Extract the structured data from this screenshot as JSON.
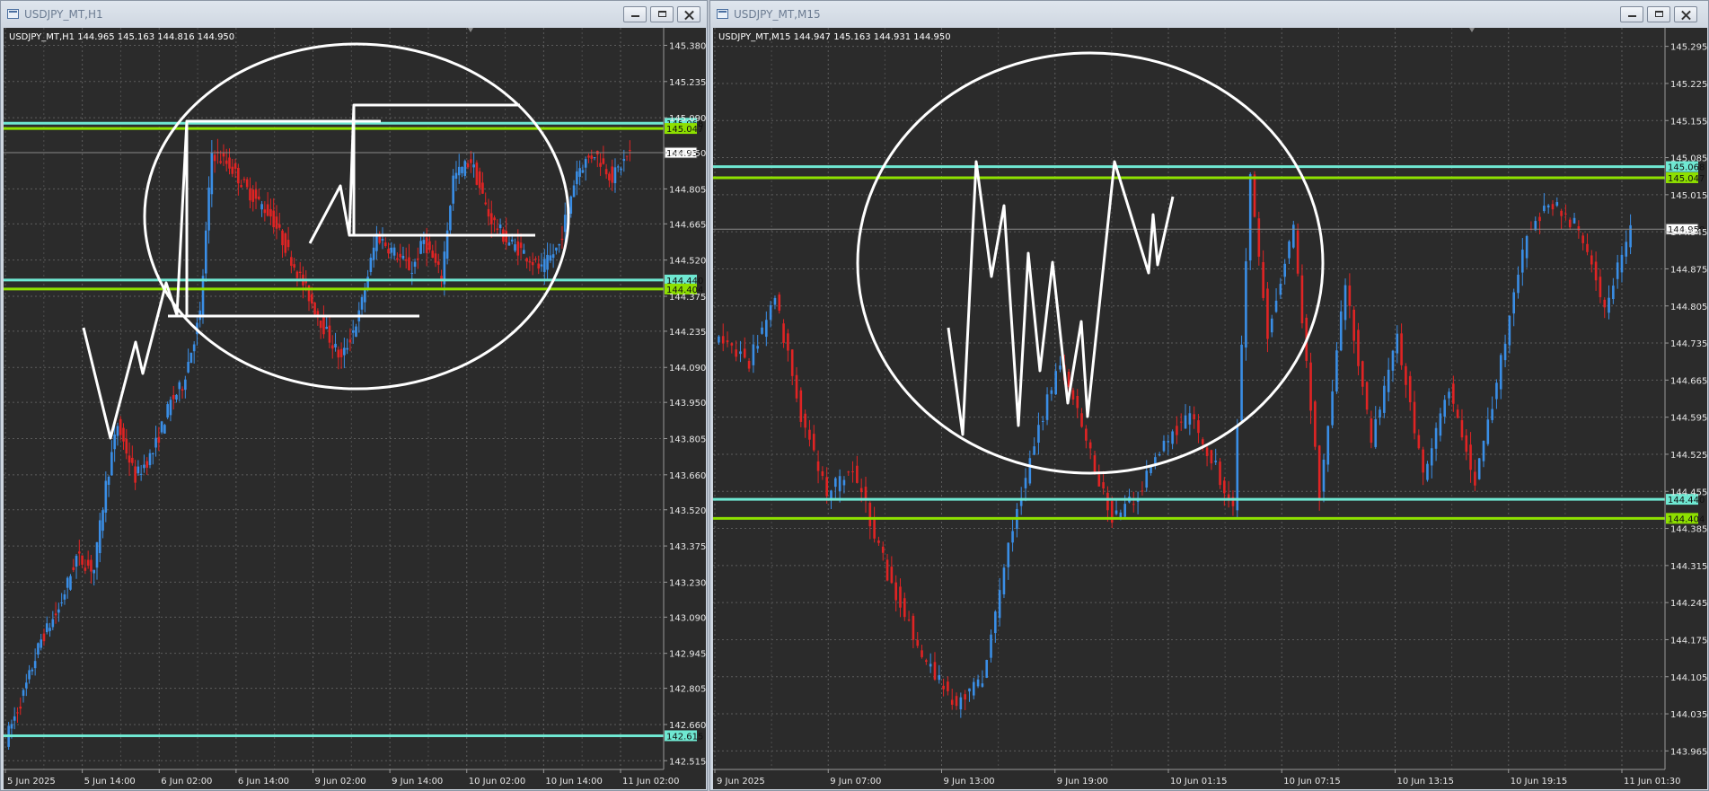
{
  "colors": {
    "background": "#2b2b2b",
    "grid": "#5a5a5a",
    "bull": "#3a8ee6",
    "bear": "#e02424",
    "cyan_level": "#6fe8d2",
    "green_level": "#8ee000",
    "marker": "#ffffff"
  },
  "windows": [
    {
      "title": "USDJPY_MT,H1",
      "info": "USDJPY_MT,H1  144.965 145.163 144.816 144.950",
      "price_ticks": [
        "145.380",
        "145.235",
        "145.090",
        "144.950",
        "144.805",
        "144.665",
        "144.520",
        "144.375",
        "144.235",
        "144.090",
        "143.950",
        "143.805",
        "143.660",
        "143.520",
        "143.375",
        "143.230",
        "143.090",
        "142.945",
        "142.805",
        "142.660",
        "142.515"
      ],
      "time_ticks": [
        "5 Jun 2025",
        "5 Jun 14:00",
        "6 Jun 02:00",
        "6 Jun 14:00",
        "9 Jun 02:00",
        "9 Jun 14:00",
        "10 Jun 02:00",
        "10 Jun 14:00",
        "11 Jun 02:00"
      ],
      "levels": [
        {
          "price": 145.068,
          "label": "145.068",
          "kind": "cyan"
        },
        {
          "price": 145.047,
          "label": "145.047",
          "kind": "green"
        },
        {
          "price": 144.44,
          "label": "144.440",
          "kind": "cyan"
        },
        {
          "price": 144.404,
          "label": "144.404",
          "kind": "green"
        },
        {
          "price": 142.615,
          "label": "142.615",
          "kind": "cyan"
        }
      ],
      "current_price": {
        "price": 144.95,
        "label": "144.950"
      },
      "chart_data": {
        "type": "candlestick",
        "symbol": "USDJPY_MT",
        "timeframe": "H1",
        "open": 144.965,
        "high": 145.163,
        "low": 144.816,
        "close": 144.95,
        "ylim": [
          142.48,
          145.45
        ],
        "price_path": [
          {
            "t": 0,
            "p": 142.6
          },
          {
            "t": 6,
            "p": 142.78
          },
          {
            "t": 12,
            "p": 143.0
          },
          {
            "t": 18,
            "p": 143.12
          },
          {
            "t": 24,
            "p": 143.33
          },
          {
            "t": 30,
            "p": 143.28
          },
          {
            "t": 34,
            "p": 143.62
          },
          {
            "t": 38,
            "p": 143.86
          },
          {
            "t": 44,
            "p": 143.65
          },
          {
            "t": 50,
            "p": 143.75
          },
          {
            "t": 56,
            "p": 143.95
          },
          {
            "t": 60,
            "p": 144.02
          },
          {
            "t": 66,
            "p": 144.3
          },
          {
            "t": 70,
            "p": 144.95
          },
          {
            "t": 76,
            "p": 144.9
          },
          {
            "t": 82,
            "p": 144.8
          },
          {
            "t": 90,
            "p": 144.7
          },
          {
            "t": 96,
            "p": 144.55
          },
          {
            "t": 102,
            "p": 144.4
          },
          {
            "t": 108,
            "p": 144.25
          },
          {
            "t": 114,
            "p": 144.12
          },
          {
            "t": 120,
            "p": 144.3
          },
          {
            "t": 126,
            "p": 144.62
          },
          {
            "t": 132,
            "p": 144.55
          },
          {
            "t": 138,
            "p": 144.48
          },
          {
            "t": 142,
            "p": 144.6
          },
          {
            "t": 148,
            "p": 144.45
          },
          {
            "t": 152,
            "p": 144.85
          },
          {
            "t": 158,
            "p": 144.92
          },
          {
            "t": 164,
            "p": 144.7
          },
          {
            "t": 170,
            "p": 144.6
          },
          {
            "t": 176,
            "p": 144.55
          },
          {
            "t": 182,
            "p": 144.48
          },
          {
            "t": 188,
            "p": 144.58
          },
          {
            "t": 194,
            "p": 144.88
          },
          {
            "t": 200,
            "p": 144.95
          },
          {
            "t": 206,
            "p": 144.85
          },
          {
            "t": 212,
            "p": 144.95
          }
        ],
        "time_ticks": [
          "5 Jun 2025",
          "5 Jun 14:00",
          "6 Jun 02:00",
          "6 Jun 14:00",
          "9 Jun 02:00",
          "9 Jun 14:00",
          "10 Jun 02:00",
          "10 Jun 14:00",
          "11 Jun 02:00"
        ]
      }
    },
    {
      "title": "USDJPY_MT,M15",
      "info": "USDJPY_MT,M15  144.947 145.163 144.931 144.950",
      "price_ticks": [
        "145.295",
        "145.225",
        "145.155",
        "145.085",
        "145.015",
        "144.945",
        "144.875",
        "144.805",
        "144.735",
        "144.665",
        "144.595",
        "144.525",
        "144.455",
        "144.385",
        "144.315",
        "144.245",
        "144.175",
        "144.105",
        "144.035",
        "143.965"
      ],
      "time_ticks": [
        "9 Jun 2025",
        "9 Jun 07:00",
        "9 Jun 13:00",
        "9 Jun 19:00",
        "10 Jun 01:15",
        "10 Jun 07:15",
        "10 Jun 13:15",
        "10 Jun 19:15",
        "11 Jun 01:30"
      ],
      "levels": [
        {
          "price": 145.068,
          "label": "145.068",
          "kind": "cyan"
        },
        {
          "price": 145.047,
          "label": "145.047",
          "kind": "green"
        },
        {
          "price": 144.44,
          "label": "144.440",
          "kind": "cyan"
        },
        {
          "price": 144.404,
          "label": "144.404",
          "kind": "green"
        }
      ],
      "current_price": {
        "price": 144.95,
        "label": "144.950"
      },
      "chart_data": {
        "type": "candlestick",
        "symbol": "USDJPY_MT",
        "timeframe": "M15",
        "open": 144.947,
        "high": 145.163,
        "low": 144.931,
        "close": 144.95,
        "ylim": [
          143.93,
          145.33
        ],
        "price_path": [
          {
            "t": 0,
            "p": 144.75
          },
          {
            "t": 8,
            "p": 144.7
          },
          {
            "t": 14,
            "p": 144.82
          },
          {
            "t": 20,
            "p": 144.6
          },
          {
            "t": 26,
            "p": 144.45
          },
          {
            "t": 32,
            "p": 144.5
          },
          {
            "t": 40,
            "p": 144.3
          },
          {
            "t": 48,
            "p": 144.15
          },
          {
            "t": 56,
            "p": 144.05
          },
          {
            "t": 62,
            "p": 144.1
          },
          {
            "t": 68,
            "p": 144.35
          },
          {
            "t": 74,
            "p": 144.55
          },
          {
            "t": 80,
            "p": 144.7
          },
          {
            "t": 86,
            "p": 144.55
          },
          {
            "t": 92,
            "p": 144.4
          },
          {
            "t": 98,
            "p": 144.45
          },
          {
            "t": 104,
            "p": 144.55
          },
          {
            "t": 110,
            "p": 144.6
          },
          {
            "t": 116,
            "p": 144.5
          },
          {
            "t": 120,
            "p": 144.42
          },
          {
            "t": 124,
            "p": 145.05
          },
          {
            "t": 128,
            "p": 144.75
          },
          {
            "t": 134,
            "p": 144.95
          },
          {
            "t": 140,
            "p": 144.45
          },
          {
            "t": 146,
            "p": 144.85
          },
          {
            "t": 152,
            "p": 144.55
          },
          {
            "t": 158,
            "p": 144.75
          },
          {
            "t": 164,
            "p": 144.48
          },
          {
            "t": 170,
            "p": 144.65
          },
          {
            "t": 176,
            "p": 144.47
          },
          {
            "t": 182,
            "p": 144.7
          },
          {
            "t": 188,
            "p": 144.95
          },
          {
            "t": 194,
            "p": 145.0
          },
          {
            "t": 200,
            "p": 144.95
          },
          {
            "t": 206,
            "p": 144.8
          },
          {
            "t": 212,
            "p": 144.95
          }
        ],
        "time_ticks": [
          "9 Jun 2025",
          "9 Jun 07:00",
          "9 Jun 13:00",
          "9 Jun 19:00",
          "10 Jun 01:15",
          "10 Jun 07:15",
          "10 Jun 13:15",
          "10 Jun 19:15",
          "11 Jun 01:30"
        ]
      }
    }
  ]
}
